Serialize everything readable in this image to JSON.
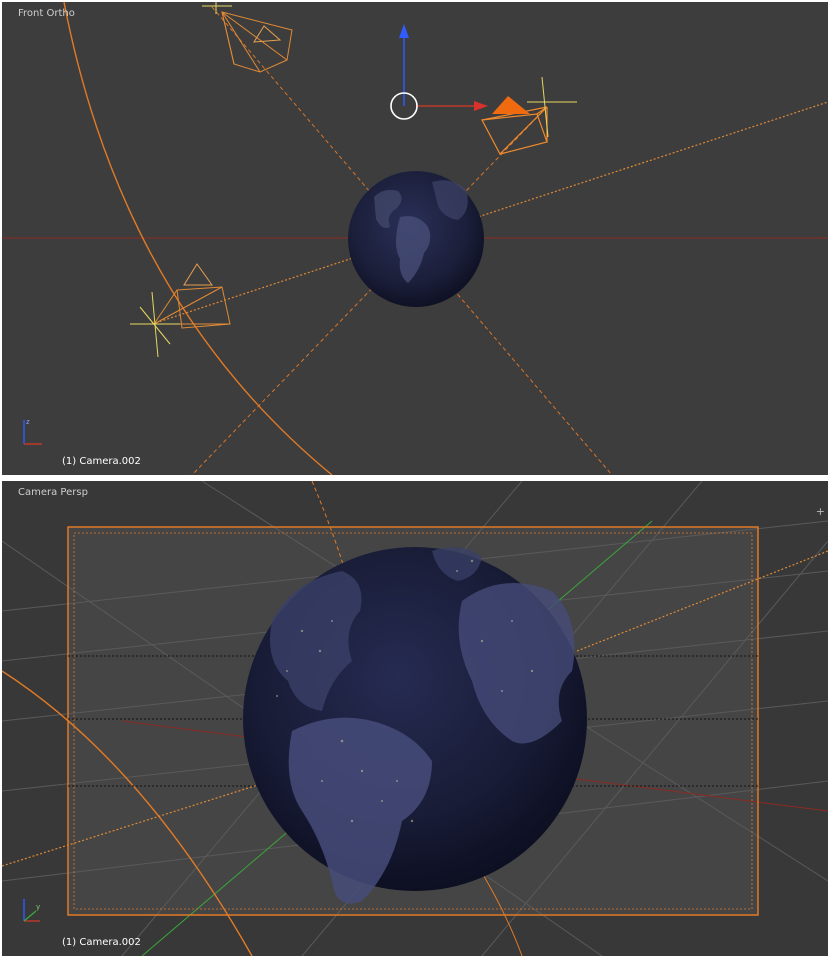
{
  "top_view": {
    "label": "Front Ortho",
    "status": "(1) Camera.002",
    "axis_widget": {
      "icon": "axis-gizmo-icon"
    }
  },
  "bottom_view": {
    "label": "Camera Persp",
    "status": "(1) Camera.002",
    "axis_widget": {
      "icon": "axis-gizmo-icon"
    }
  },
  "colors": {
    "viewport_bg": "#3d3d3d",
    "selection_orange": "#f08a2c",
    "x_axis_red": "#c0392b",
    "y_axis_green": "#3aa83a",
    "z_axis_blue": "#2f5bff",
    "earth_ocean": "#1b1f3a"
  }
}
